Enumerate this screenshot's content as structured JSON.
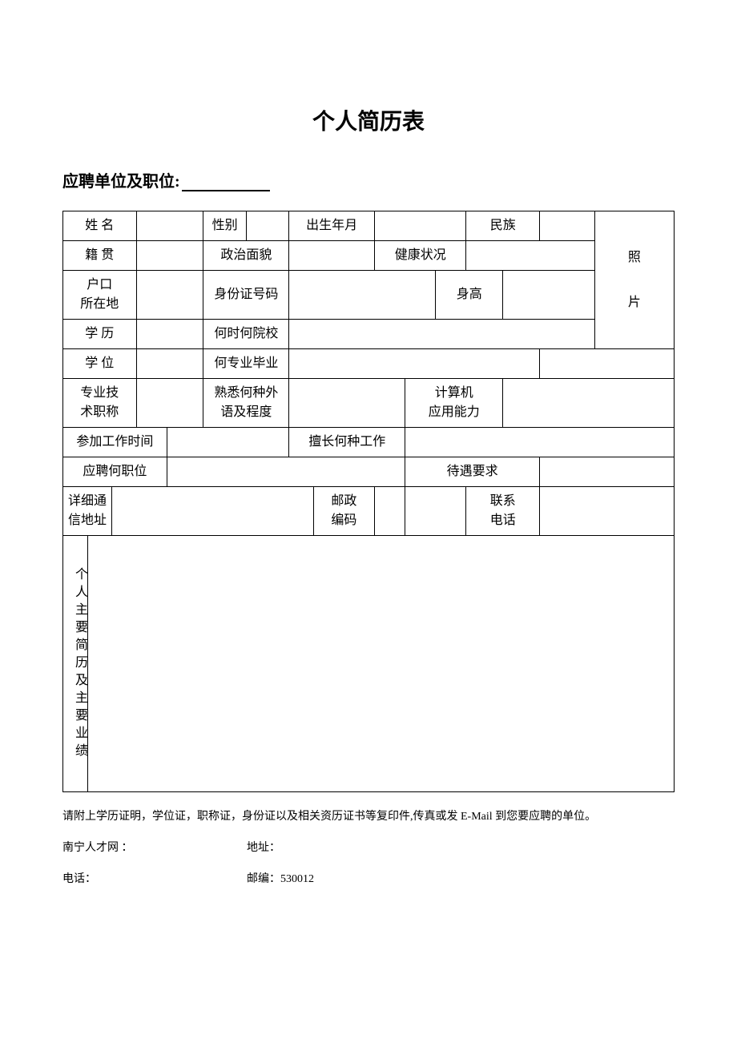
{
  "title": "个人简历表",
  "subtitle_prefix": "应聘单位及职位:",
  "labels": {
    "name": "姓 名",
    "gender": "性别",
    "birth": "出生年月",
    "ethnic": "民族",
    "native": "籍 贯",
    "politics": "政治面貌",
    "health": "健康状况",
    "hukou1": "户口",
    "hukou2": "所在地",
    "idcard": "身份证号码",
    "height": "身高",
    "edu": "学 历",
    "school": "何时何院校",
    "degree": "学 位",
    "major": "何专业毕业",
    "proftitle1": "专业技",
    "proftitle2": "术职称",
    "lang1": "熟悉何种外",
    "lang2": "语及程度",
    "computer1": "计算机",
    "computer2": "应用能力",
    "workstart": "参加工作时间",
    "goodat": "擅长何种工作",
    "applypos": "应聘何职位",
    "salary": "待遇要求",
    "address1": "详细通",
    "address2": "信地址",
    "postcode1": "邮政",
    "postcode2": "编码",
    "phone1": "联系",
    "phone2": "电话",
    "photo1": "照",
    "photo2": "片",
    "resume_vert": "个人主要简历及主要业绩"
  },
  "note": "请附上学历证明，学位证，职称证，身份证以及相关资历证书等复印件,传真或发 E-Mail 到您要应聘的单位。",
  "footer": {
    "site_label": "南宁人才网 ：",
    "addr_label": "地址：",
    "tel_label": "电话：",
    "zip_label": "邮编：",
    "zip_value": "530012"
  }
}
